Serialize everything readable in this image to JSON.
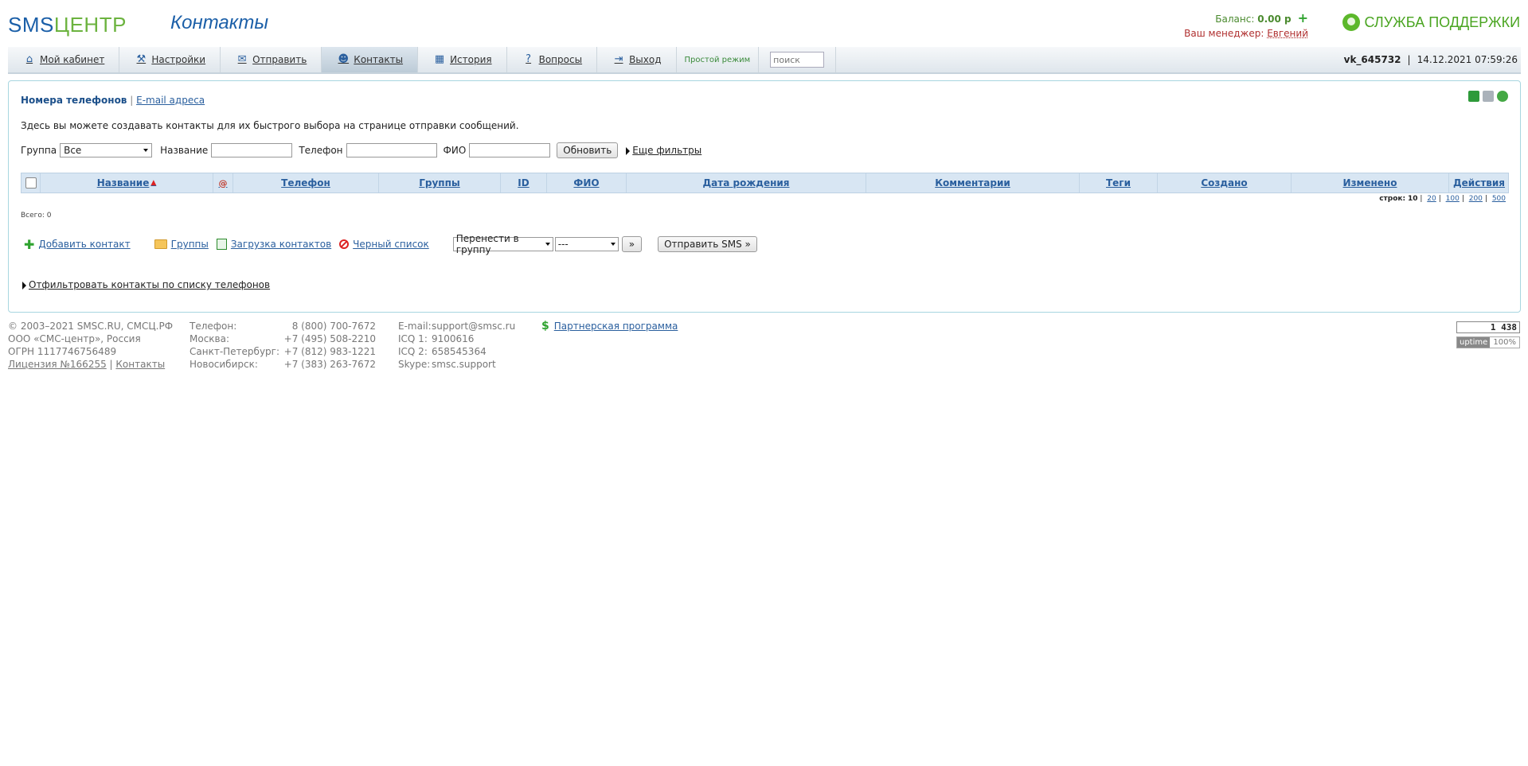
{
  "header": {
    "logo_sms": "SMS",
    "logo_center": "ЦЕНТР",
    "page_title": "Контакты",
    "balance_label": "Баланс:",
    "balance_value": "0.00 р",
    "manager_label": "Ваш менеджер:",
    "manager_name": "Евгений",
    "support": "СЛУЖБА ПОДДЕРЖКИ"
  },
  "nav": {
    "tabs": [
      {
        "label": "Мой кабинет",
        "icon": "home-icon"
      },
      {
        "label": "Настройки",
        "icon": "tools-icon"
      },
      {
        "label": "Отправить",
        "icon": "envelope-icon"
      },
      {
        "label": "Контакты",
        "icon": "contacts-icon"
      },
      {
        "label": "История",
        "icon": "calendar-icon"
      },
      {
        "label": "Вопросы",
        "icon": "question-icon"
      },
      {
        "label": "Выход",
        "icon": "exit-icon"
      }
    ],
    "simple_mode": "Простой режим",
    "search_placeholder": "поиск",
    "user": "vk_645732",
    "datetime": "14.12.2021 07:59:26"
  },
  "panel": {
    "subtab_phones": "Номера телефонов",
    "subtab_email": "E-mail адреса",
    "description": "Здесь вы можете создавать контакты для их быстрого выбора на странице отправки сообщений.",
    "filters": {
      "group_label": "Группа",
      "group_value": "Все",
      "name_label": "Название",
      "phone_label": "Телефон",
      "fio_label": "ФИО",
      "refresh_button": "Обновить",
      "more_filters": "Еще фильтры"
    },
    "columns": [
      "Название",
      "@",
      "Телефон",
      "Группы",
      "ID",
      "ФИО",
      "Дата рождения",
      "Комментарии",
      "Теги",
      "Создано",
      "Изменено",
      "Действия"
    ],
    "rows_label": "строк:",
    "rows_current": "10",
    "rows_options": [
      "20",
      "100",
      "200",
      "500"
    ],
    "total": "Всего: 0",
    "actions": {
      "add_contact": "Добавить контакт",
      "groups": "Группы",
      "load_contacts": "Загрузка контактов",
      "blacklist": "Черный список",
      "move_to_group": "Перенести в группу",
      "group_target": "---",
      "go_button": "»",
      "send_sms": "Отправить SMS »"
    },
    "filter_by_list": "Отфильтровать контакты по списку телефонов"
  },
  "footer": {
    "copyright": "© 2003–2021 SMSC.RU, СМСЦ.РФ",
    "company": "ООО «СМС-центр», Россия",
    "ogrn": "ОГРН 1117746756489",
    "license": "Лицензия №166255",
    "contacts_link": "Контакты",
    "phones": [
      {
        "city": "Телефон:",
        "number": "8 (800) 700-7672"
      },
      {
        "city": "Москва:",
        "number": "+7 (495) 508-2210"
      },
      {
        "city": "Санкт-Петербург:",
        "number": "+7 (812) 983-1221"
      },
      {
        "city": "Новосибирск:",
        "number": "+7 (383) 263-7672"
      }
    ],
    "messengers": [
      {
        "label": "E-mail:",
        "value": "support@smsc.ru"
      },
      {
        "label": "ICQ 1:",
        "value": "9100616"
      },
      {
        "label": "ICQ 2:",
        "value": "658545364"
      },
      {
        "label": "Skype:",
        "value": "smsc.support"
      }
    ],
    "partner": "Партнерская программа",
    "counter": "1 438",
    "uptime_label": "uptime",
    "uptime_value": "100%"
  },
  "colors": {
    "brand_blue": "#1b5fa8",
    "brand_green": "#6cb33f",
    "link": "#2a5f9e"
  }
}
